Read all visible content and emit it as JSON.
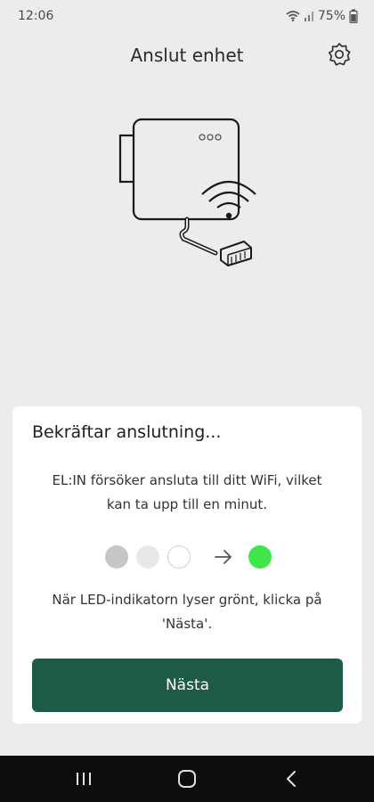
{
  "status_bar": {
    "time": "12:06",
    "battery": "75%",
    "icons": [
      "wifi-icon",
      "signal-icon",
      "battery-icon"
    ]
  },
  "header": {
    "title": "Anslut enhet",
    "settings_icon": "gear-icon"
  },
  "illustration": {
    "led_label": "ooo"
  },
  "card": {
    "title": "Bekräftar anslutning...",
    "description": "EL:IN försöker ansluta till ditt WiFi, vilket kan ta upp till en minut.",
    "hint": "När LED-indikatorn lyser grönt, klicka på 'Nästa'.",
    "led_sequence": {
      "colors": [
        "#c6c6c6",
        "#e8e8e8",
        "#ffffff"
      ],
      "target_color": "#3ee64a",
      "arrow_icon": "arrow-right-icon"
    },
    "next_label": "Nästa"
  },
  "nav_bar": {
    "icons": [
      "recent-apps-icon",
      "home-icon",
      "back-icon"
    ]
  },
  "colors": {
    "background": "#ececec",
    "card": "#ffffff",
    "primary_button": "#1e5b45",
    "led_green": "#3ee64a"
  }
}
